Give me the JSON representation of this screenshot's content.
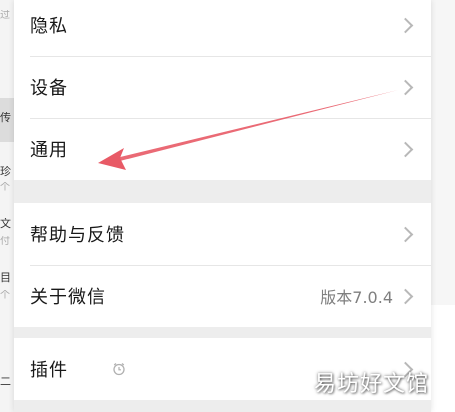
{
  "settings": {
    "group1": [
      {
        "label": "隐私"
      },
      {
        "label": "设备"
      },
      {
        "label": "通用"
      }
    ],
    "group2": [
      {
        "label": "帮助与反馈"
      },
      {
        "label": "关于微信",
        "value": "版本7.0.4"
      }
    ],
    "group3": [
      {
        "label": "插件"
      }
    ]
  },
  "background_list": {
    "fragments": [
      "过",
      "传",
      "珍",
      "个",
      "文",
      "付",
      "目",
      "个",
      "二"
    ]
  },
  "watermark": "易坊好文馆",
  "colors": {
    "annotation_arrow": "#e85a66",
    "panel_bg": "#ededed",
    "row_bg": "#ffffff"
  },
  "icons": {
    "row_chevron": "chevron-right-icon",
    "plugin_badge": "plugin-clock-icon"
  }
}
